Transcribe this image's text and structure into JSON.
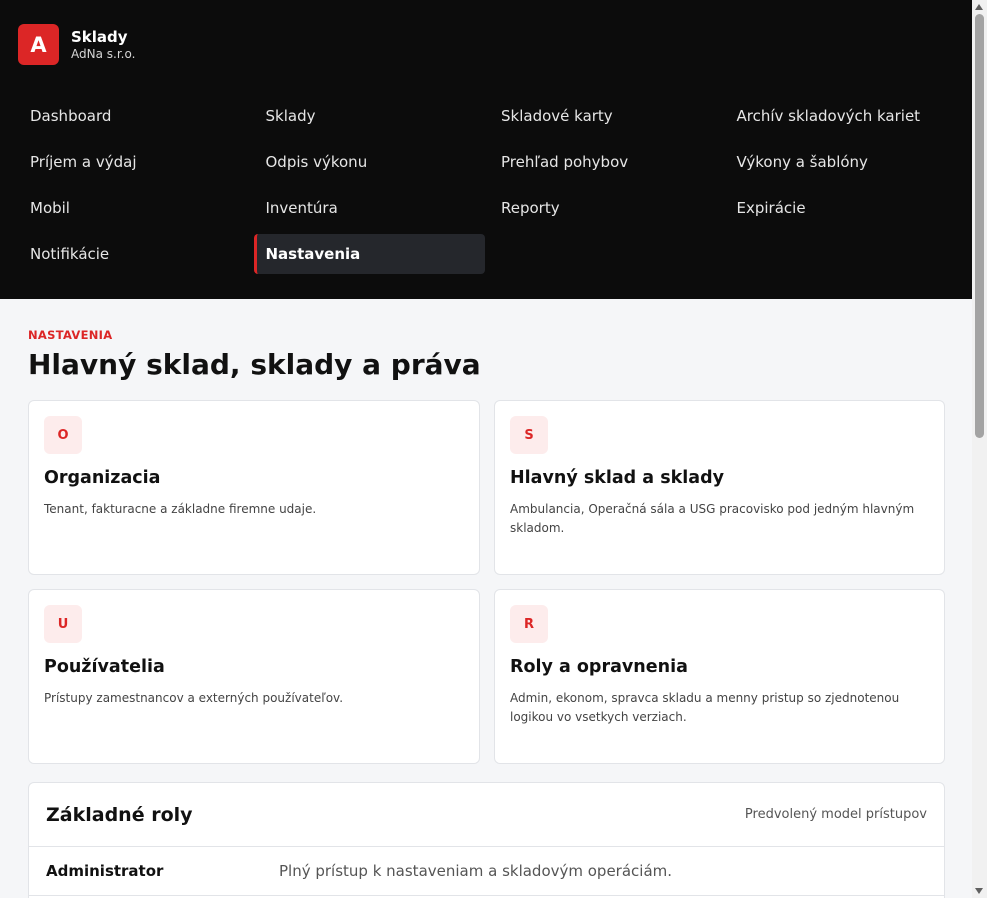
{
  "brand": {
    "logo_letter": "A",
    "name": "Sklady",
    "company": "AdNa s.r.o.",
    "accent": "#dc2626"
  },
  "nav": {
    "items": [
      {
        "label": "Dashboard"
      },
      {
        "label": "Sklady"
      },
      {
        "label": "Skladové karty"
      },
      {
        "label": "Archív skladových kariet"
      },
      {
        "label": "Príjem a výdaj"
      },
      {
        "label": "Odpis výkonu"
      },
      {
        "label": "Prehľad pohybov"
      },
      {
        "label": "Výkony a šablóny"
      },
      {
        "label": "Mobil"
      },
      {
        "label": "Inventúra"
      },
      {
        "label": "Reporty"
      },
      {
        "label": "Expirácie"
      },
      {
        "label": "Notifikácie"
      },
      {
        "label": "Nastavenia",
        "active": true
      }
    ]
  },
  "page": {
    "section": "NASTAVENIA",
    "title": "Hlavný sklad, sklady a práva"
  },
  "cards": [
    {
      "badge": "O",
      "title": "Organizacia",
      "desc": "Tenant, fakturacne a základne firemne udaje."
    },
    {
      "badge": "S",
      "title": "Hlavný sklad a sklady",
      "desc": "Ambulancia, Operačná sála a USG pracovisko pod jedným hlavným skladom."
    },
    {
      "badge": "U",
      "title": "Používatelia",
      "desc": "Prístupy zamestnancov a externých používateľov."
    },
    {
      "badge": "R",
      "title": "Roly a opravnenia",
      "desc": "Admin, ekonom, spravca skladu a menny pristup so zjednotenou logikou vo vsetkych verziach."
    }
  ],
  "roles": {
    "title": "Základné roly",
    "hint": "Predvolený model prístupov",
    "rows": [
      {
        "name": "Administrator",
        "desc": "Plný prístup k nastaveniam a skladovým operáciám."
      }
    ]
  }
}
